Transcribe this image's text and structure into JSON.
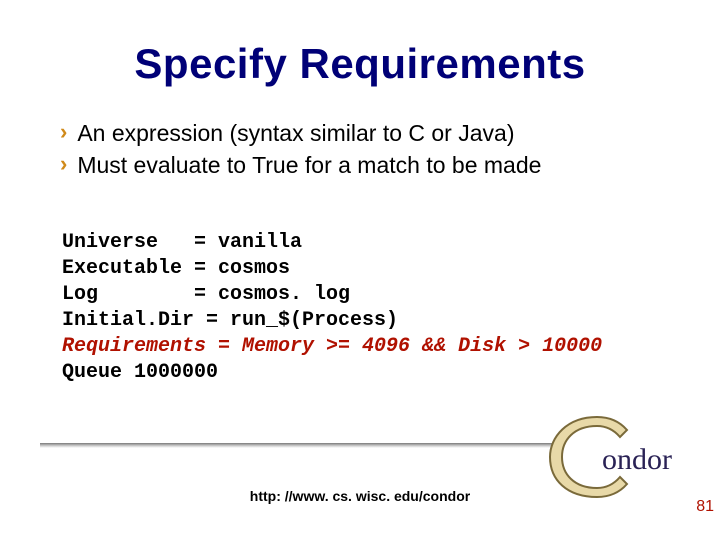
{
  "title": "Specify Requirements",
  "bullets": [
    "An expression (syntax similar to C or Java)",
    "Must evaluate to True for a match to be made"
  ],
  "code": {
    "l1": "Universe   = vanilla",
    "l2": "Executable = cosmos",
    "l3": "Log        = cosmos. log",
    "l4": "Initial.Dir = run_$(Process)",
    "l5": "Requirements = Memory >= 4096 && Disk > 10000",
    "l6": "Queue 1000000"
  },
  "footer_url": "http: //www. cs. wisc. edu/condor",
  "page_number": "81",
  "logo_text": "ondor"
}
